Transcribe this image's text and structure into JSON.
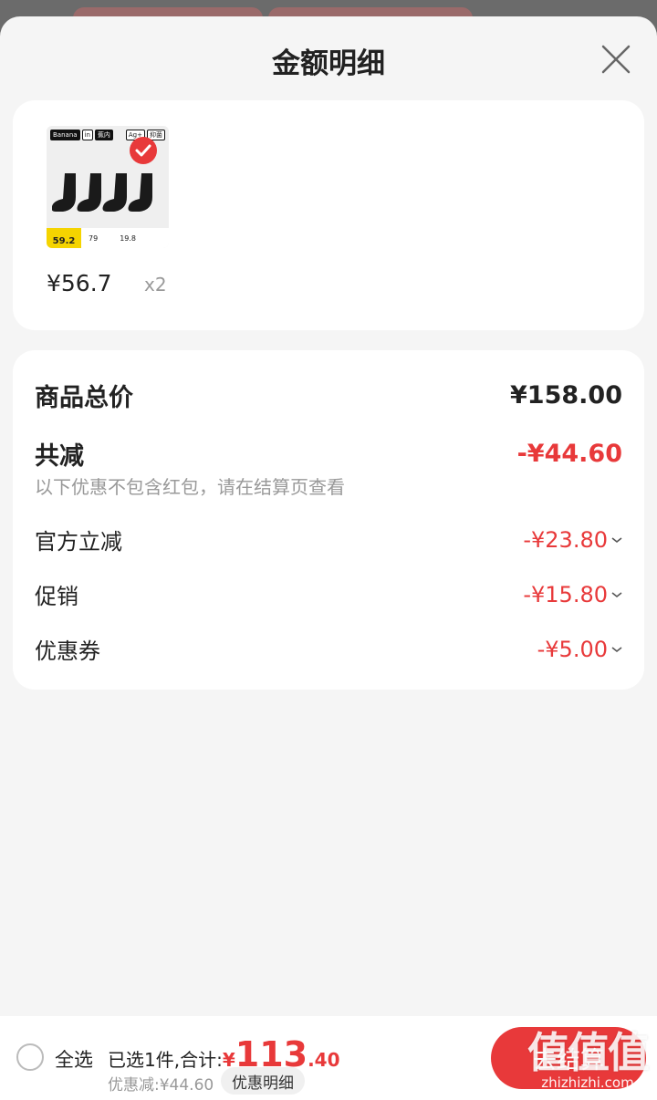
{
  "sheet": {
    "title": "金额明细"
  },
  "product": {
    "thumb_tags": [
      "Banana",
      "in",
      "蕉内"
    ],
    "thumb_tags_right": [
      "Ag+",
      "抑菌"
    ],
    "thumb_price": "59.2",
    "thumb_num1": "79",
    "thumb_num2": "19.8",
    "price_symbol": "¥",
    "price_int": "56",
    "price_dec": ".7",
    "quantity": "x2"
  },
  "details": {
    "total_label": "商品总价",
    "total_value": "¥158.00",
    "reduce_label": "共减",
    "reduce_value": "-¥44.60",
    "note": "以下优惠不包含红包，请在结算页查看",
    "items": [
      {
        "label": "官方立减",
        "value": "-¥23.80"
      },
      {
        "label": "促销",
        "value": "-¥15.80"
      },
      {
        "label": "优惠券",
        "value": "-¥5.00"
      }
    ]
  },
  "footer": {
    "select_all": "全选",
    "selected_text": "已选1件,合计:",
    "total_symbol": "¥",
    "total_int": "113",
    "total_dec": ".40",
    "discount_text": "优惠减:¥44.60",
    "detail_chip": "优惠明细",
    "checkout": "去结算"
  },
  "watermark": {
    "text": "值值值",
    "url": "zhizhizhi.com"
  },
  "colors": {
    "accent_red": "#e8393a",
    "background": "#f5f5f5"
  }
}
